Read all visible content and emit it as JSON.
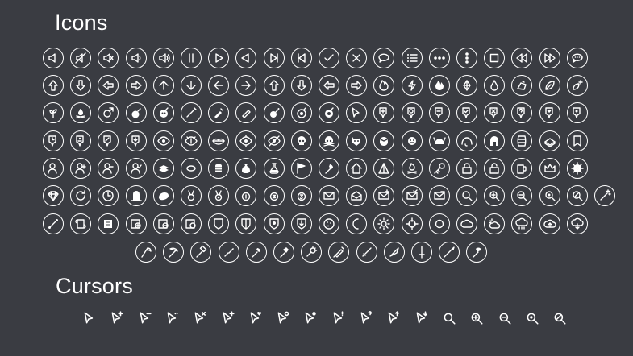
{
  "headings": {
    "icons": "Icons",
    "cursors": "Cursors"
  },
  "colors": {
    "background": "#3a3c42",
    "foreground": "#ffffff"
  },
  "icons": {
    "rows": [
      [
        "speaker-icon",
        "speaker-muted-icon",
        "speaker-off-icon",
        "speaker-low-icon",
        "speaker-high-icon",
        "pause-icon",
        "play-icon",
        "reverse-play-icon",
        "skip-forward-icon",
        "skip-back-icon",
        "check-icon",
        "cross-icon",
        "speech-bubble-icon",
        "list-icon",
        "more-horizontal-icon",
        "more-vertical-icon",
        "stop-icon",
        "rewind-icon",
        "fast-forward-icon",
        "chat-ellipsis-icon"
      ],
      [
        "arrow-up-outline-icon",
        "arrow-down-outline-icon",
        "arrow-left-outline-icon",
        "arrow-right-outline-icon",
        "arrow-up-icon",
        "arrow-down-icon",
        "arrow-left-icon",
        "arrow-right-icon",
        "chevron-arrow-up-icon",
        "chevron-arrow-down-icon",
        "chevron-arrow-left-icon",
        "chevron-arrow-right-icon",
        "fire-outline-icon",
        "lightning-icon",
        "flame-icon",
        "crystal-icon",
        "water-drop-icon",
        "foot-icon",
        "leaf-icon",
        "sparkle-leaf-icon"
      ],
      [
        "plant-icon",
        "bonfire-icon",
        "male-icon",
        "bomb-icon",
        "skull-bomb-icon",
        "wand-icon",
        "potion-icon",
        "tube-icon",
        "bomb-fuse-icon",
        "eye-bomb-icon",
        "bomb-gear-icon",
        "pointer-icon",
        "pin-plus-icon",
        "pin-refresh-icon",
        "pin-minus-icon",
        "pin-check-icon",
        "pin-cross-icon",
        "pin-question-icon",
        "pin-heart-icon",
        "pin-settings-icon"
      ],
      [
        "pin-clock-icon",
        "pin-person-icon",
        "pin-edit-icon",
        "pin-down-icon",
        "eye-icon",
        "eye-slit-icon",
        "lips-icon",
        "eye-target-icon",
        "eye-off-icon",
        "skull-icon",
        "skull-crossbones-icon",
        "demon-mask-icon",
        "alien-icon",
        "monster-icon",
        "viking-helmet-icon",
        "mammoth-icon",
        "spartan-helmet-icon",
        "barrel-icon",
        "chest-icon",
        "bookmark-icon"
      ],
      [
        "user-icon",
        "user-plus-icon",
        "user-minus-icon",
        "user-check-icon",
        "coins-stack-icon",
        "coin-icon",
        "coin-tower-icon",
        "money-bag-icon",
        "potion-flask-icon",
        "flag-icon",
        "torch-icon",
        "house-icon",
        "tent-icon",
        "campfire-icon",
        "key-icon",
        "lock-closed-icon",
        "lock-open-icon",
        "beer-mug-icon",
        "crown-icon",
        "gear-icon"
      ],
      [
        "diamond-icon",
        "refresh-circle-icon",
        "clock-icon",
        "grave-icon",
        "bread-icon",
        "medal-ribbon-icon",
        "medal-coin-icon",
        "medal-one-icon",
        "medal-two-icon",
        "medal-three-icon",
        "mail-icon",
        "mail-open-icon",
        "mail-plus-icon",
        "mail-check-icon",
        "mail-minus-icon",
        "search-icon",
        "zoom-in-icon",
        "zoom-out-icon",
        "zoom-reset-icon",
        "zoom-off-icon",
        "magic-wand-icon"
      ],
      [
        "scroll-bone-icon",
        "scroll-icon",
        "scroll-paper-icon",
        "map-zoom-in-icon",
        "map-zoom-out-icon",
        "map-zoom-circle-icon",
        "shield-icon",
        "shield-split-icon",
        "shield-emblem-icon",
        "shield-arrow-icon",
        "cookie-icon",
        "moon-icon",
        "sun-icon",
        "crosshair-icon",
        "circle-icon",
        "cloud-icon",
        "cloud-sun-icon",
        "cloud-rain-icon",
        "cloud-upload-icon",
        "cloud-download-icon"
      ],
      [
        "scythe-icon",
        "pickaxe-icon",
        "hammer-icon",
        "chisel-icon",
        "torch-stick-icon",
        "war-hammer-icon",
        "mace-icon",
        "syringe-icon",
        "dagger-icon",
        "blade-icon",
        "sword-icon",
        "spear-icon",
        "axe-icon"
      ]
    ]
  },
  "cursors": [
    "cursor-arrow-icon",
    "cursor-plus-icon",
    "cursor-minus-icon",
    "cursor-dots-icon",
    "cursor-cross-icon",
    "cursor-bar-icon",
    "cursor-heart-icon",
    "cursor-gear-icon",
    "cursor-coin-icon",
    "cursor-exclamation-icon",
    "cursor-question-icon",
    "cursor-up-icon",
    "cursor-down-icon",
    "cursor-search-icon",
    "cursor-zoom-in-icon",
    "cursor-zoom-out-icon",
    "cursor-zoom-reset-icon",
    "cursor-zoom-off-icon"
  ]
}
